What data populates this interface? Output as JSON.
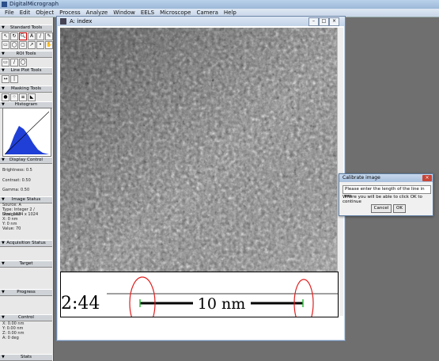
{
  "app": {
    "title": "DigitalMicrograph"
  },
  "menu": [
    "File",
    "Edit",
    "Object",
    "Process",
    "Analyze",
    "Window",
    "EELS",
    "Microscope",
    "Camera",
    "Help"
  ],
  "panel": {
    "sections": [
      "Standard Tools",
      "ROI Tools",
      "Line Plot Tools",
      "Masking Tools",
      "Histogram",
      "Display Control",
      "Image Status",
      "Acquisition Status",
      "Target",
      "Progress",
      "Control",
      "Stats"
    ],
    "display": {
      "brightness": "Brightness: 0.5",
      "contrast": "Contrast: 0.50",
      "gamma": "Gamma: 0.50"
    },
    "status": [
      "Source: A",
      "Type: Integer 2 / Unsigned",
      "Size: 1024 x 1024",
      "X: 0 nm",
      "Y: 0 nm",
      "Value: 70"
    ],
    "control": [
      "X: 0.00 nm",
      "Y: 0.00 nm",
      "Z: 0.00 nm",
      "A: 0 deg"
    ]
  },
  "image_window": {
    "title": "A: index"
  },
  "scale": {
    "left_label": "2:44",
    "bar_label": "10 nm"
  },
  "dialog": {
    "title": "Calibrate image",
    "prompt": "Please enter the length of the line in nm",
    "message": "Where you will be able to click OK to continue",
    "cancel": "Cancel",
    "ok": "OK"
  }
}
